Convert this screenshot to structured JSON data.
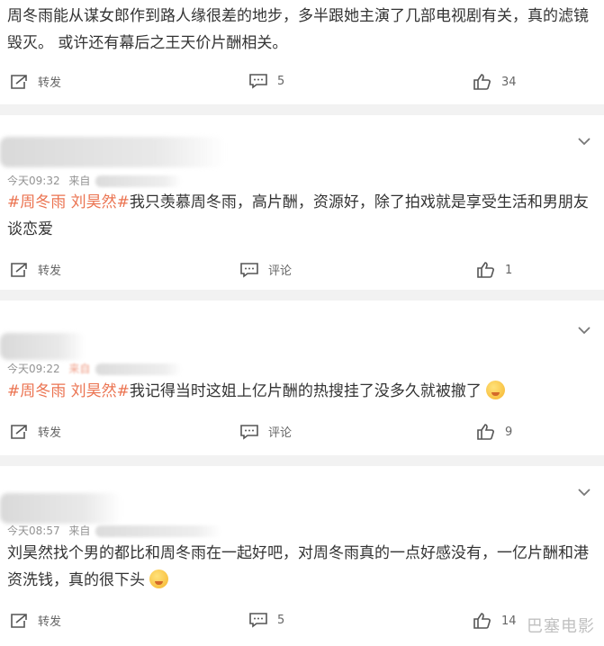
{
  "comments": [
    {
      "text_parts": [
        {
          "t": "周冬雨能从谋女郎作到路人缘很差的地步，多半跟她主演了几部电视剧有关，真的滤镜毁灭。 或许还有幕后之王天价片酬相关。",
          "tag": false
        }
      ],
      "actions": {
        "repost": "转发",
        "comment": "5",
        "like": "34"
      }
    },
    {
      "time": "今天09:32",
      "from": "来自",
      "text_parts": [
        {
          "t": "#周冬雨 刘昊然#",
          "tag": true
        },
        {
          "t": "我只羡慕周冬雨，高片酬，资源好，除了拍戏就是享受生活和男朋友谈恋爱",
          "tag": false
        }
      ],
      "actions": {
        "repost": "转发",
        "comment": "评论",
        "like": "1"
      }
    },
    {
      "time": "今天09:22",
      "from": "来自",
      "text_parts": [
        {
          "t": "#周冬雨 刘昊然#",
          "tag": true
        },
        {
          "t": "我记得当时这姐上亿片酬的热搜挂了没多久就被撤了",
          "tag": false
        }
      ],
      "actions": {
        "repost": "转发",
        "comment": "评论",
        "like": "9"
      }
    },
    {
      "time": "今天08:57",
      "from": "来自",
      "text_parts": [
        {
          "t": "刘昊然找个男的都比和周冬雨在一起好吧，对周冬雨真的一点好感没有，一亿片酬和港资洗钱，真的很下头",
          "tag": false
        }
      ],
      "actions": {
        "repost": "转发",
        "comment": "5",
        "like": "14"
      }
    }
  ],
  "icons": {
    "repost": "repost-icon",
    "comment": "comment-icon",
    "like": "thumbs-up-icon",
    "more": "chevron-down-icon",
    "emoji1": "drooling-emoji",
    "emoji2": "sweat-emoji"
  },
  "watermark": "巴塞电影",
  "colors": {
    "tag": "#eb7350",
    "meta": "#939393",
    "background": "#f2f2f2"
  }
}
